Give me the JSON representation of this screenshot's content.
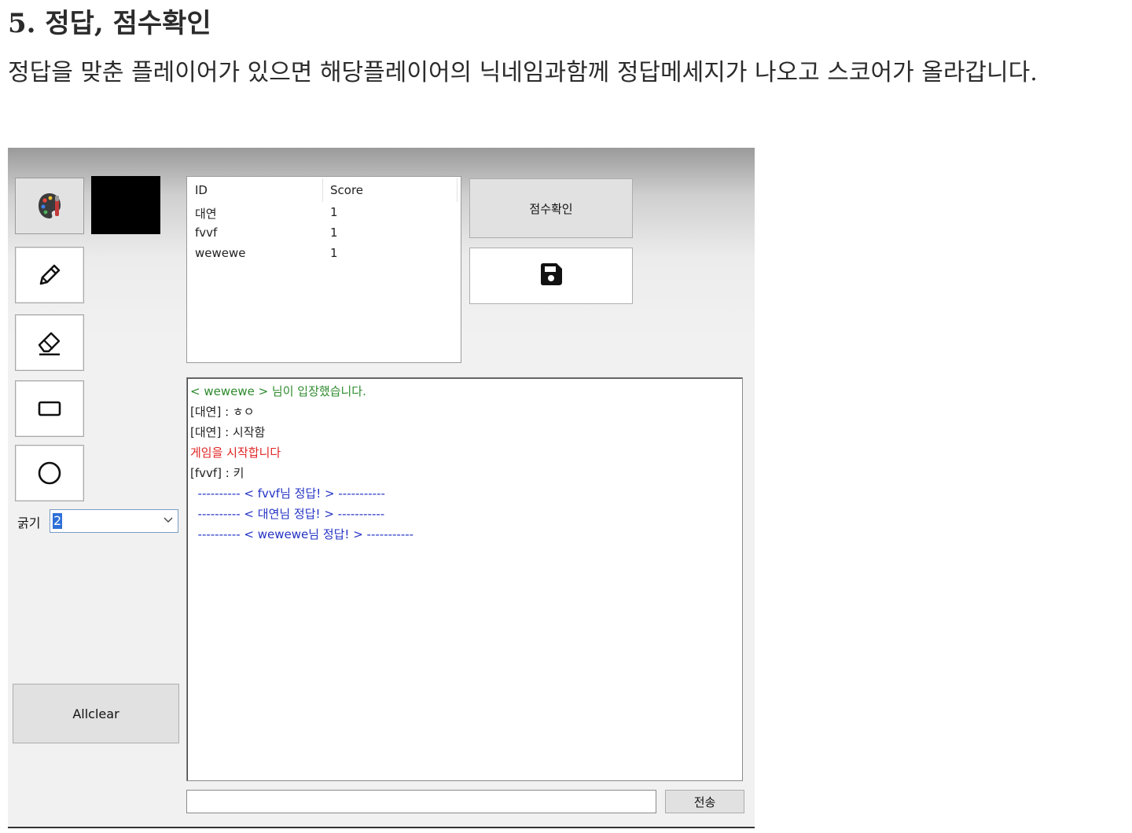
{
  "doc": {
    "heading": "5. 정답, 점수확인",
    "description": "정답을 맞춘 플레이어가 있으면 해당플레이어의 닉네임과함께 정답메세지가 나오고 스코어가 올라갑니다."
  },
  "toolbar": {
    "tools": [
      {
        "icon": "palette-icon"
      },
      {
        "icon": "pencil-icon"
      },
      {
        "icon": "eraser-icon"
      },
      {
        "icon": "rectangle-icon"
      },
      {
        "icon": "circle-icon"
      }
    ],
    "current_color": "#000000",
    "thickness_label": "굵기",
    "thickness_value": "2",
    "allclear_label": "Allclear"
  },
  "scoreboard": {
    "columns": [
      "ID",
      "Score"
    ],
    "rows": [
      {
        "id": "대연",
        "score": "1"
      },
      {
        "id": "fvvf",
        "score": "1"
      },
      {
        "id": "wewewe",
        "score": "1"
      }
    ],
    "check_button_label": "점수확인",
    "save_icon": "floppy-disk-icon"
  },
  "chat": {
    "lines": [
      {
        "text": "< wewewe > 님이 입장했습니다.",
        "color": "green"
      },
      {
        "text": "[대연] : ㅎㅇ",
        "color": "black"
      },
      {
        "text": "[대연] : 시작함",
        "color": "black"
      },
      {
        "text": "게임을 시작합니다",
        "color": "red"
      },
      {
        "text": "[fvvf] : 키",
        "color": "black"
      },
      {
        "text": "  ---------- < fvvf님 정답! > -----------",
        "color": "blue"
      },
      {
        "text": "  ---------- < 대연님 정답! > -----------",
        "color": "blue"
      },
      {
        "text": "  ---------- < wewewe님 정답! > -----------",
        "color": "blue"
      }
    ],
    "input_value": "",
    "send_label": "전송"
  },
  "colors": {
    "green": "#2e8b2e",
    "red": "#e02424",
    "blue": "#2433c4"
  }
}
